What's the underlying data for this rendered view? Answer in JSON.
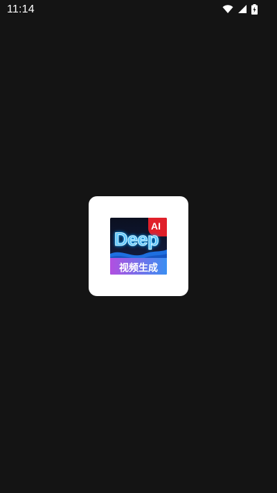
{
  "status_bar": {
    "time": "11:14",
    "icons": [
      "wifi-icon",
      "cellular-signal-icon",
      "battery-charging-icon"
    ]
  },
  "splash": {
    "background_color": "#141414",
    "card_color": "#ffffff",
    "logo": {
      "badge": "AI",
      "word": "Deep",
      "caption": "视频生成",
      "colors": {
        "badge": "#e0202a",
        "top": "#0b1020",
        "wave": "#1e6fe0",
        "bottom_left": "#b24fe0",
        "bottom_right": "#3a8ff2",
        "word": "#5fc8ff"
      }
    }
  }
}
